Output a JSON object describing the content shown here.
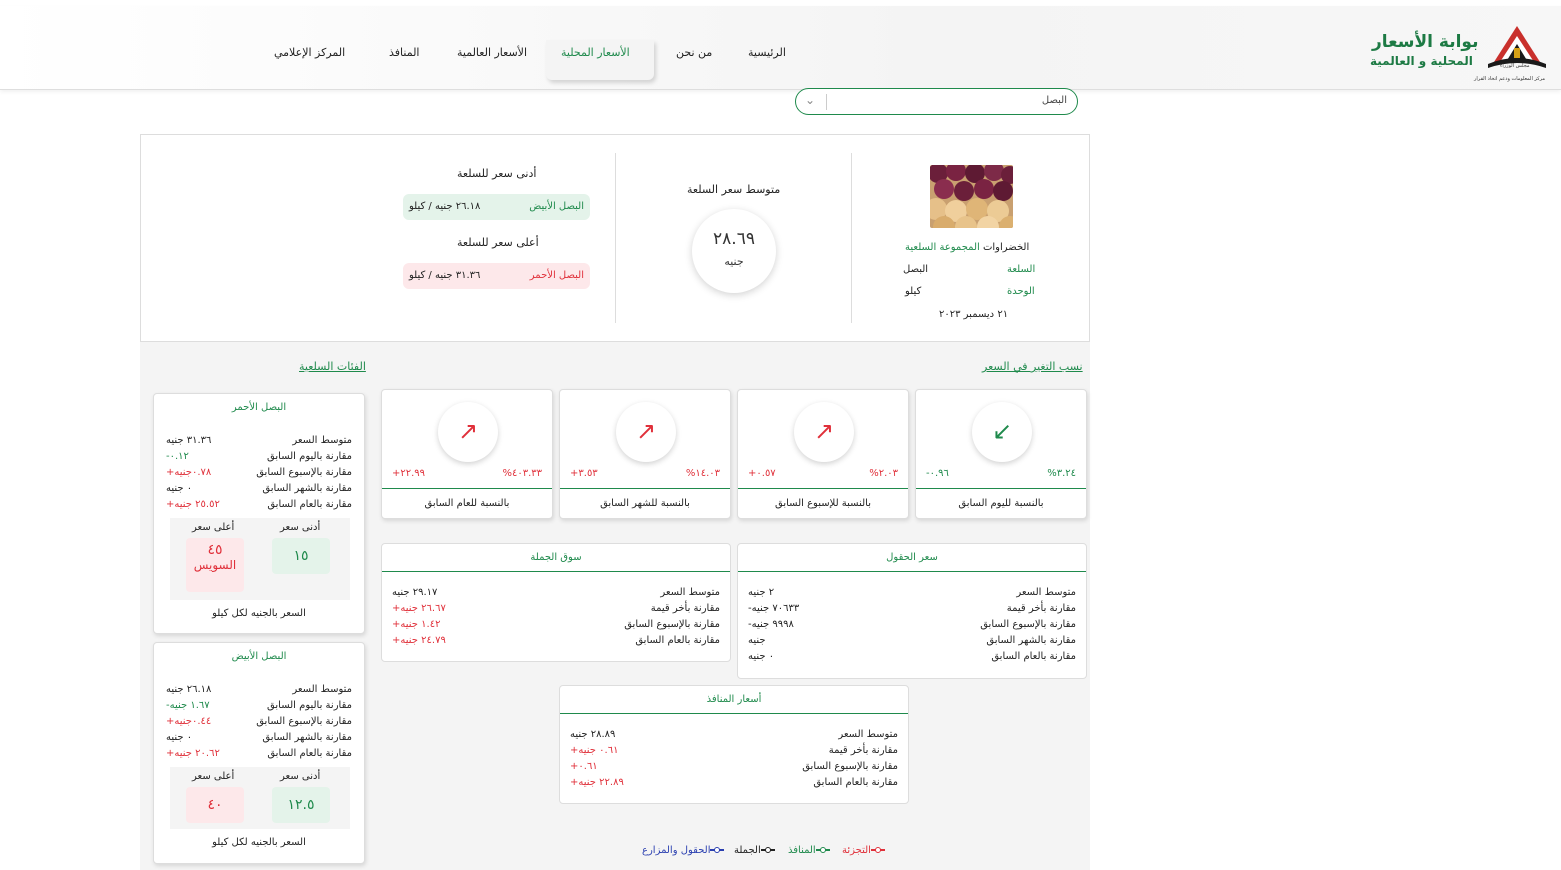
{
  "header": {
    "title": "بوابة الأسعار",
    "subtitle": "المحلية و العالمية",
    "emblem_caption": "مجلس الوزراء",
    "emblem_org": "مركز المعلومات ودعم اتخاذ القرار",
    "nav": [
      {
        "label": "الرئيسية"
      },
      {
        "label": "من نحن"
      },
      {
        "label": "الأسعار المحلية"
      },
      {
        "label": "الأسعار العالمية"
      },
      {
        "label": "المنافذ"
      },
      {
        "label": "المركز الإعلامي"
      }
    ],
    "active_index": 2
  },
  "select": {
    "value": "البصل"
  },
  "summary": {
    "group_label": "المجموعة السلعية",
    "group_value": "الخضراوات",
    "commodity_label": "السلعة",
    "commodity_value": "البصل",
    "unit_label": "الوحدة",
    "unit_value": "كيلو",
    "date": "٢١ ديسمبر ٢٠٢٣",
    "avg_title": "متوسط سعر السلعة",
    "avg_value": "٢٨.٦٩",
    "avg_unit": "جنيه",
    "min_title": "أدنى سعر للسلعة",
    "min_item": "البصل الأبيض",
    "min_price": "٢٦.١٨ جنيه / كيلو",
    "max_title": "أعلى سعر للسلعة",
    "max_item": "البصل الأحمر",
    "max_price": "٣١.٣٦ جنيه / كيلو"
  },
  "changes": {
    "title": "نسب التغير في السعر",
    "cards": [
      {
        "label": "بالنسبة لليوم السابق",
        "value": "-٠.٩٦",
        "percent": "%٣.٢٤",
        "direction": "down",
        "color": "#1f8a4c"
      },
      {
        "label": "بالنسبة للإسبوع السابق",
        "value": "+٠.٥٧",
        "percent": "%٢.٠٣",
        "direction": "up",
        "color": "#e0303a"
      },
      {
        "label": "بالنسبة للشهر السابق",
        "value": "+٣.٥٣",
        "percent": "%١٤.٠٣",
        "direction": "up",
        "color": "#e0303a"
      },
      {
        "label": "بالنسبة للعام السابق",
        "value": "+٢٢.٩٩",
        "percent": "%٤٠٣.٣٣",
        "direction": "up",
        "color": "#e0303a"
      }
    ]
  },
  "markets": {
    "fields": {
      "title": "سعر الحقول",
      "rows": [
        {
          "k": "متوسط السعر",
          "v": "٢ جنيه",
          "c": "dark"
        },
        {
          "k": "مقارنة بأخر قيمة",
          "v": "-٧٠٦٣٣ جنيه",
          "c": "dark"
        },
        {
          "k": "مقارنة بالإسبوع السابق",
          "v": "-٩٩٩٨ جنيه",
          "c": "dark"
        },
        {
          "k": "مقارنة بالشهر السابق",
          "v": "جنيه",
          "c": "dark"
        },
        {
          "k": "مقارنة بالعام السابق",
          "v": "٠ جنيه",
          "c": "dark"
        }
      ]
    },
    "wholesale": {
      "title": "سوق الجملة",
      "rows": [
        {
          "k": "متوسط السعر",
          "v": "٢٩.١٧ جنيه",
          "c": "dark"
        },
        {
          "k": "مقارنة بأخر قيمة",
          "v": "+٢٦.٦٧ جنيه",
          "c": "red"
        },
        {
          "k": "مقارنة بالإسبوع السابق",
          "v": "+١.٤٢ جنيه",
          "c": "red"
        },
        {
          "k": "مقارنة بالعام السابق",
          "v": "+٢٤.٧٩ جنيه",
          "c": "red"
        }
      ]
    },
    "outlets": {
      "title": "أسعار المنافذ",
      "rows": [
        {
          "k": "متوسط السعر",
          "v": "٢٨.٨٩ جنيه",
          "c": "dark"
        },
        {
          "k": "مقارنة بأخر قيمة",
          "v": "+٠.٦١ جنيه",
          "c": "red"
        },
        {
          "k": "مقارنة بالإسبوع السابق",
          "v": "+٠.٦١",
          "c": "red"
        },
        {
          "k": "مقارنة بالعام السابق",
          "v": "+٢٢.٨٩ جنيه",
          "c": "red"
        }
      ]
    }
  },
  "categories": {
    "title": "الفئات السلعية",
    "min_label": "أدنى سعر",
    "max_label": "أعلى سعر",
    "footer": "السعر بالجنيه لكل كيلو",
    "items": [
      {
        "title": "البصل الأحمر",
        "rows": [
          {
            "k": "متوسط السعر",
            "v": "٣١.٣٦ جنيه",
            "c": "dark"
          },
          {
            "k": "مقارنة باليوم السابق",
            "v": "-٠.١٢",
            "c": "green"
          },
          {
            "k": "مقارنة بالإسبوع السابق",
            "v": "+٠.٧٨جنيه",
            "c": "red"
          },
          {
            "k": "مقارنة بالشهر السابق",
            "v": "٠ جنيه",
            "c": "dark"
          },
          {
            "k": "مقارنة بالعام السابق",
            "v": "+٢٥.٥٢ جنيه",
            "c": "red"
          }
        ],
        "min": "١٥",
        "max": "٤٥",
        "max_place": "السويس"
      },
      {
        "title": "البصل الأبيض",
        "rows": [
          {
            "k": "متوسط السعر",
            "v": "٢٦.١٨ جنيه",
            "c": "dark"
          },
          {
            "k": "مقارنة باليوم السابق",
            "v": "-١.٦٧ جنيه",
            "c": "green"
          },
          {
            "k": "مقارنة بالإسبوع السابق",
            "v": "+٠.٤٤جنيه",
            "c": "red"
          },
          {
            "k": "مقارنة بالشهر السابق",
            "v": "٠ جنيه",
            "c": "dark"
          },
          {
            "k": "مقارنة بالعام السابق",
            "v": "+٢٠.٦٢ جنيه",
            "c": "red"
          }
        ],
        "min": "١٢.٥",
        "max": "٤٠",
        "max_place": ""
      }
    ]
  },
  "legend": [
    {
      "label": "التجزئة",
      "color": "#e0303a"
    },
    {
      "label": "المنافذ",
      "color": "#1f8a4c"
    },
    {
      "label": "الجملة",
      "color": "#222222"
    },
    {
      "label": "الحقول والمزارع",
      "color": "#2a3fb0"
    }
  ]
}
